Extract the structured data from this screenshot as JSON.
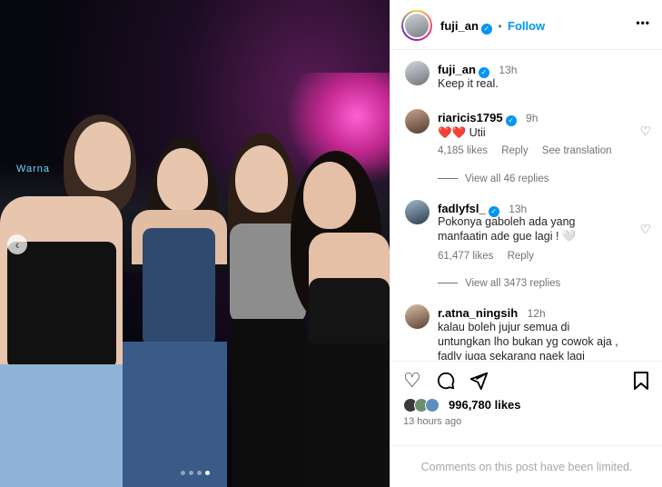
{
  "post": {
    "author": "fuji_an",
    "follow_label": "Follow",
    "more_label": "•••",
    "caption": "Keep it real.",
    "caption_time": "13h",
    "photo_sign": "Warna",
    "carousel": {
      "total": 4,
      "active": 4
    }
  },
  "comments": [
    {
      "username": "riaricis1795",
      "verified": true,
      "time": "9h",
      "text": "❤️❤️ Utii",
      "likes": "4,185 likes",
      "reply": "Reply",
      "translate": "See translation",
      "view_replies": "View all 46 replies"
    },
    {
      "username": "fadlyfsl_",
      "verified": true,
      "time": "13h",
      "text_line1": "Pokonya gaboleh ada yang",
      "text_line2": "manfaatin ade gue lagi ! 🤍",
      "likes": "61,477 likes",
      "reply": "Reply",
      "view_replies": "View all 3473 replies"
    },
    {
      "username": "r.atna_ningsih",
      "verified": false,
      "time": "12h",
      "text_line1": "kalau boleh jujur semua di",
      "text_line2": "untungkan lho bukan yg cowok aja ,",
      "text_line3": "fadly juga sekarang naek lagi"
    }
  ],
  "stats": {
    "likes": "996,780 likes",
    "posted": "13 hours ago"
  },
  "footer": {
    "limited": "Comments on this post have been limited."
  },
  "colors": {
    "accent": "#0095f6",
    "muted": "#737373",
    "limited_text": "#a8a8a8",
    "heart": "#ed4956"
  },
  "icons": {
    "like": "heart-icon",
    "comment": "comment-icon",
    "share": "share-icon",
    "save": "bookmark-icon"
  }
}
